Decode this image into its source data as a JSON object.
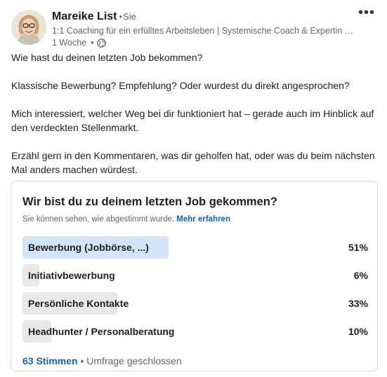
{
  "author": {
    "name": "Mareike List",
    "self_badge": "Sie",
    "headline": "1:1 Coaching für ein erfülltes Arbeitsleben | Systemische Coach & Expertin für ...",
    "time_ago": "1 Woche",
    "visibility_icon": "globe-icon"
  },
  "post": {
    "paragraphs": [
      "Wie hast du deinen letzten Job bekommen?",
      "Klassische Bewerbung? Empfehlung? Oder wurdest du direkt angesprochen?",
      "Mich interessiert, welcher Weg bei dir funktioniert hat – gerade auch im Hinblick auf den verdeckten Stellenmarkt.",
      "Erzähl gern in den Kommentaren, was dir geholfen hat, oder was du beim nächsten Mal anders machen würdest."
    ]
  },
  "poll": {
    "question": "Wir bist du zu deinem letzten Job gekommen?",
    "note": "Sie können sehen, wie abgestimmt wurde.",
    "learn_more": "Mehr erfahren",
    "options": [
      {
        "label": "Bewerbung (Jobbörse, ...)",
        "percent_label": "51%",
        "percent": 51,
        "selected": true
      },
      {
        "label": "Initiativbewerbung",
        "percent_label": "6%",
        "percent": 6,
        "selected": false
      },
      {
        "label": "Persönliche Kontakte",
        "percent_label": "33%",
        "percent": 33,
        "selected": false
      },
      {
        "label": "Headhunter / Personalberatung",
        "percent_label": "10%",
        "percent": 10,
        "selected": false
      }
    ],
    "votes": "63 Stimmen",
    "status": "Umfrage geschlossen"
  },
  "colors": {
    "link": "#0a66c2",
    "selected_bar": "#d2e5fa",
    "bar": "#e8e8e8"
  }
}
